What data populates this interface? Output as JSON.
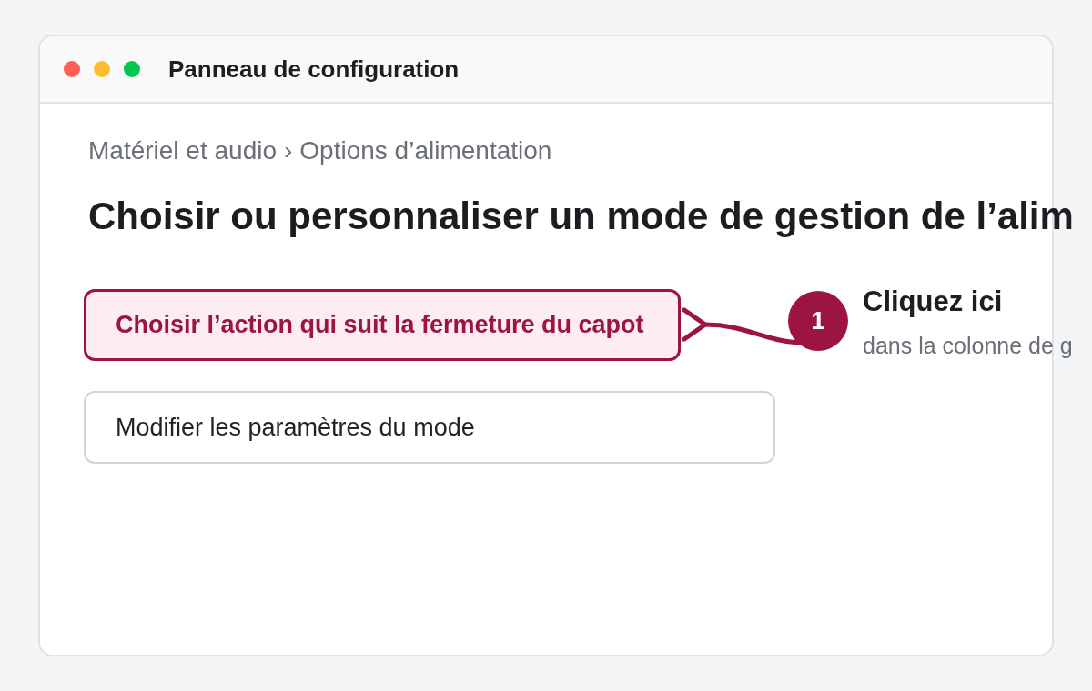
{
  "window": {
    "title": "Panneau de configuration",
    "controls": [
      {
        "color": "#ff5f57"
      },
      {
        "color": "#febc2e"
      },
      {
        "color": "#00c74d"
      }
    ]
  },
  "breadcrumb": {
    "items": [
      "Matériel et audio",
      "Options d’alimentation"
    ],
    "separator": "›"
  },
  "heading": "Choisir ou personnaliser un mode de gestion de l’alim",
  "options": [
    {
      "label": "Choisir l’action qui suit la fermeture du capot",
      "highlighted": true
    },
    {
      "label": "Modifier les paramètres du mode",
      "highlighted": false
    }
  ],
  "callout": {
    "step": "1",
    "title": "Cliquez ici",
    "text": "dans la colonne de g"
  }
}
